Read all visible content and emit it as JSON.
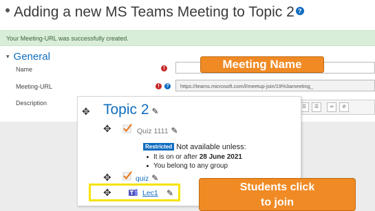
{
  "page": {
    "title": "Adding a new MS Teams Meeting to Topic 2"
  },
  "notice": {
    "message": "Your Meeting-URL was successfully created."
  },
  "form": {
    "section_title": "General",
    "fields": {
      "name_label": "Name",
      "name_value": "",
      "url_label": "Meeting-URL",
      "url_value": "https://teams.microsoft.com/l/meetup-join/19%3ameeting_",
      "description_label": "Description"
    }
  },
  "callouts": {
    "meeting_name": "Meeting Name",
    "students_line1": "Students click",
    "students_line2": "to join"
  },
  "topic": {
    "title": "Topic 2",
    "activities": [
      {
        "name": "Quiz 1111",
        "icon": "quiz-check-icon"
      },
      {
        "name": "quiz",
        "icon": "quiz-check-icon"
      },
      {
        "name": "Lec1",
        "icon": "ms-teams-icon"
      }
    ],
    "restriction": {
      "badge": "Restricted",
      "text": "Not available unless:",
      "condition1_prefix": "It is on or after",
      "condition1_date": "28 June 2021",
      "condition2": "You belong to any group"
    }
  },
  "colors": {
    "accent": "#0f6cbf",
    "callout": "#f08a24",
    "highlight": "#f5e300",
    "notice_bg": "#d9eed9"
  }
}
